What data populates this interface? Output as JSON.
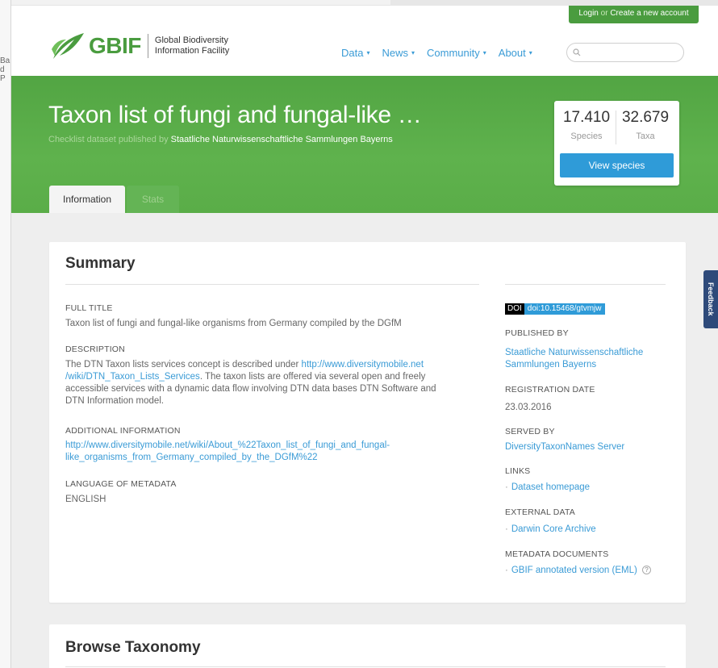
{
  "left_strip": {
    "fragments": [
      "Ba",
      "d P"
    ]
  },
  "header": {
    "login_text": "Login",
    "login_or": "or",
    "create_text": "Create a new account",
    "logo_wordmark": "GBIF",
    "logo_sub_line1": "Global Biodiversity",
    "logo_sub_line2": "Information Facility",
    "nav": [
      {
        "label": "Data"
      },
      {
        "label": "News"
      },
      {
        "label": "Community"
      },
      {
        "label": "About"
      }
    ],
    "search_placeholder": ""
  },
  "hero": {
    "title": "Taxon list of fungi and fungal-like …",
    "subtitle_prefix": "Checklist dataset published by",
    "publisher": "Staatliche Naturwissenschaftliche Sammlungen Bayerns",
    "species_count": "17.410",
    "species_label": "Species",
    "taxa_count": "32.679",
    "taxa_label": "Taxa",
    "view_species_label": "View species",
    "tabs": [
      {
        "label": "Information",
        "active": true
      },
      {
        "label": "Stats",
        "active": false
      }
    ]
  },
  "feedback_label": "Feedback",
  "summary": {
    "heading": "Summary",
    "full_title_label": "FULL TITLE",
    "full_title": "Taxon list of fungi and fungal-like organisms from Germany compiled by the DGfM",
    "description_label": "DESCRIPTION",
    "description_prefix": "The DTN Taxon lists services concept is described under",
    "description_link_line1": "http://www.diversitymobile.net",
    "description_link_line2": "/wiki/DTN_Taxon_Lists_Services",
    "description_rest_line2": ". The taxon lists are offered via several open and freely",
    "description_line3": "accessible services with a dynamic data flow involving DTN data bases DTN Software and",
    "description_line4": "DTN Information model.",
    "additional_label": "ADDITIONAL INFORMATION",
    "additional_link_line1": "http://www.diversitymobile.net/wiki/About_%22Taxon_list_of_fungi_and_fungal-",
    "additional_link_line2": "like_organisms_from_Germany_compiled_by_the_DGfM%22",
    "language_label": "LANGUAGE OF METADATA",
    "language_value": "ENGLISH"
  },
  "sidebar": {
    "doi_label": "DOI",
    "doi_value": "doi:10.15468/gtvmjw",
    "published_by_label": "PUBLISHED BY",
    "published_by_line1": "Staatliche Naturwissenschaftliche",
    "published_by_line2": "Sammlungen Bayerns",
    "registration_label": "REGISTRATION DATE",
    "registration_value": "23.03.2016",
    "served_by_label": "SERVED BY",
    "served_by_value": "DiversityTaxonNames Server",
    "links_label": "LINKS",
    "links_item": "Dataset homepage",
    "external_label": "EXTERNAL DATA",
    "external_item": "Darwin Core Archive",
    "metadata_label": "METADATA DOCUMENTS",
    "metadata_item": "GBIF annotated version (EML)"
  },
  "browse": {
    "heading": "Browse Taxonomy"
  },
  "colors": {
    "brand_green": "#5aad4a",
    "link_blue": "#3a9bd6",
    "button_blue": "#2f9bd8"
  }
}
